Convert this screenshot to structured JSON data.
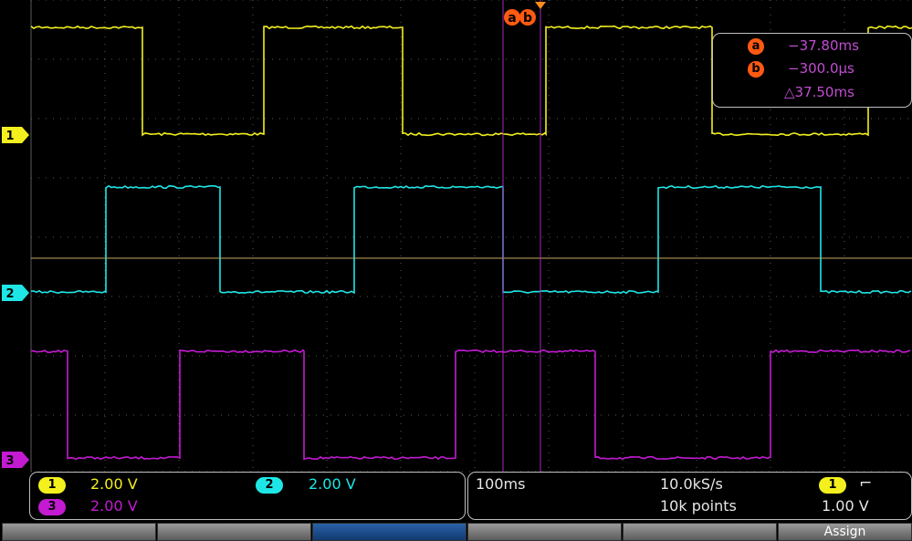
{
  "cursors": {
    "a": {
      "label": "a",
      "time_ms": -37.8
    },
    "b": {
      "label": "b",
      "time_ms": -0.3
    }
  },
  "readout": {
    "a_value": "−37.80ms",
    "b_value": "−300.0µs",
    "delta_value": "△37.50ms"
  },
  "channels": [
    {
      "id": "1",
      "color": "#f3f01e",
      "scale": "2.00 V"
    },
    {
      "id": "2",
      "color": "#1fe6e6",
      "scale": "2.00 V"
    },
    {
      "id": "3",
      "color": "#c31ad2",
      "scale": "2.00 V"
    }
  ],
  "acquisition": {
    "timebase": "100ms",
    "sample_rate": "10.0kS/s",
    "record_length": "10k points",
    "trigger_channel": "1",
    "trigger_slope_icon": "rising-edge-icon",
    "trigger_slope_glyph": "⌐",
    "trigger_level": "1.00 V"
  },
  "softkeys": [
    {
      "label": ""
    },
    {
      "label": ""
    },
    {
      "label": ""
    },
    {
      "label": ""
    },
    {
      "label": ""
    },
    {
      "label": "Assign"
    }
  ],
  "colors": {
    "grid": "#5a5a5a",
    "cursor_line": "#a52bb6",
    "cursor_badge": "#ff5a12",
    "trigger_marker": "#ff8c1a"
  }
}
